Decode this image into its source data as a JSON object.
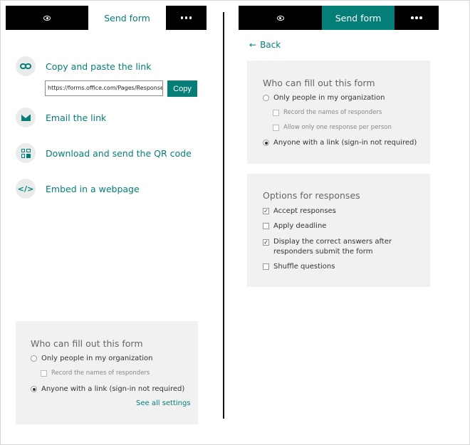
{
  "left": {
    "tab_label": "Send form",
    "share_options": [
      {
        "label": "Copy and paste the link"
      },
      {
        "label": "Email the link"
      },
      {
        "label": "Download and send the QR code"
      },
      {
        "label": "Embed in a webpage"
      }
    ],
    "link_url": "https://forms.office.com/Pages/ResponsePage",
    "copy_label": "Copy",
    "settings": {
      "title": "Who can fill out this form",
      "org_label": "Only people in my organization",
      "record_label": "Record the names of responders",
      "anyone_label": "Anyone with a link (sign-in not required)",
      "see_all": "See all settings"
    }
  },
  "right": {
    "tab_label": "Send form",
    "back_label": "Back",
    "who": {
      "title": "Who can fill out this form",
      "org_label": "Only people in my organization",
      "record_label": "Record the names of responders",
      "one_response_label": "Allow only one response per person",
      "anyone_label": "Anyone with a link (sign-in not required)"
    },
    "options": {
      "title": "Options for responses",
      "accept_label": "Accept responses",
      "deadline_label": "Apply deadline",
      "display_label": "Display the correct answers after responders submit the form",
      "shuffle_label": "Shuffle questions"
    }
  },
  "icons": {
    "eye": "eye-icon",
    "more": "more-options-icon",
    "link": "link-icon",
    "email": "email-icon",
    "qr": "qr-code-icon",
    "embed": "embed-code-icon",
    "back": "back-arrow-icon"
  },
  "colors": {
    "accent": "#047e76",
    "panel": "#f1f1f1",
    "header": "#000000"
  }
}
